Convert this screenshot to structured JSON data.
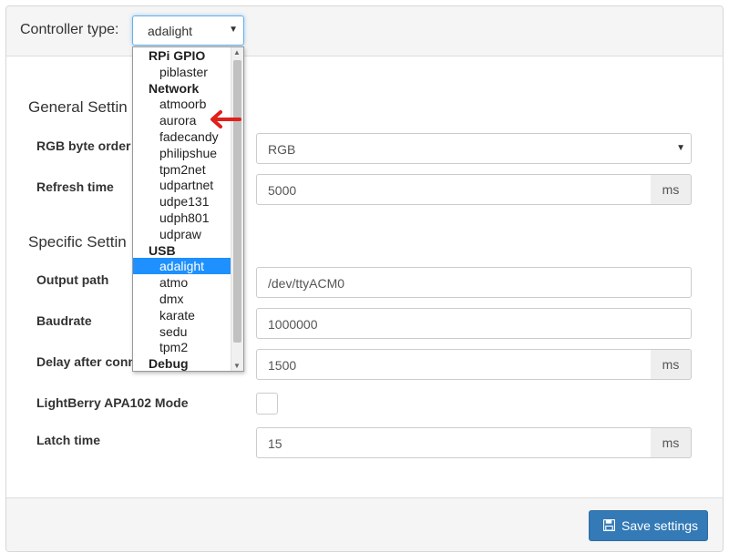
{
  "header": {
    "label": "Controller type:",
    "selected_value": "adalight"
  },
  "sections": {
    "general_title": "General Settin",
    "specific_title": "Specific Settin"
  },
  "fields": {
    "rgb_byte_order": {
      "label": "RGB byte order",
      "value": "RGB"
    },
    "refresh_time": {
      "label": "Refresh time",
      "value": "5000",
      "unit": "ms"
    },
    "output_path": {
      "label": "Output path",
      "value": "/dev/ttyACM0"
    },
    "baudrate": {
      "label": "Baudrate",
      "value": "1000000"
    },
    "delay_after_connect": {
      "label": "Delay after conn",
      "value": "1500",
      "unit": "ms"
    },
    "lightberry_mode": {
      "label": "LightBerry APA102 Mode",
      "checked": false
    },
    "latch_time": {
      "label": "Latch time",
      "value": "15",
      "unit": "ms"
    }
  },
  "footer": {
    "save_label": "Save settings"
  },
  "dropdown": {
    "items": [
      {
        "type": "group",
        "label": "RPi GPIO"
      },
      {
        "type": "option",
        "label": "piblaster"
      },
      {
        "type": "group",
        "label": "Network"
      },
      {
        "type": "option",
        "label": "atmoorb"
      },
      {
        "type": "option",
        "label": "aurora"
      },
      {
        "type": "option",
        "label": "fadecandy"
      },
      {
        "type": "option",
        "label": "philipshue"
      },
      {
        "type": "option",
        "label": "tpm2net"
      },
      {
        "type": "option",
        "label": "udpartnet"
      },
      {
        "type": "option",
        "label": "udpe131"
      },
      {
        "type": "option",
        "label": "udph801"
      },
      {
        "type": "option",
        "label": "udpraw"
      },
      {
        "type": "group",
        "label": "USB"
      },
      {
        "type": "option",
        "label": "adalight",
        "selected": true
      },
      {
        "type": "option",
        "label": "atmo"
      },
      {
        "type": "option",
        "label": "dmx"
      },
      {
        "type": "option",
        "label": "karate"
      },
      {
        "type": "option",
        "label": "sedu"
      },
      {
        "type": "option",
        "label": "tpm2"
      },
      {
        "type": "group",
        "label": "Debug"
      }
    ]
  },
  "icons": {
    "save": "floppy-disk-icon",
    "pointer": "red-arrow-icon"
  },
  "colors": {
    "primary": "#337ab7",
    "selected": "#1e90ff",
    "annotation": "#e0201a"
  }
}
